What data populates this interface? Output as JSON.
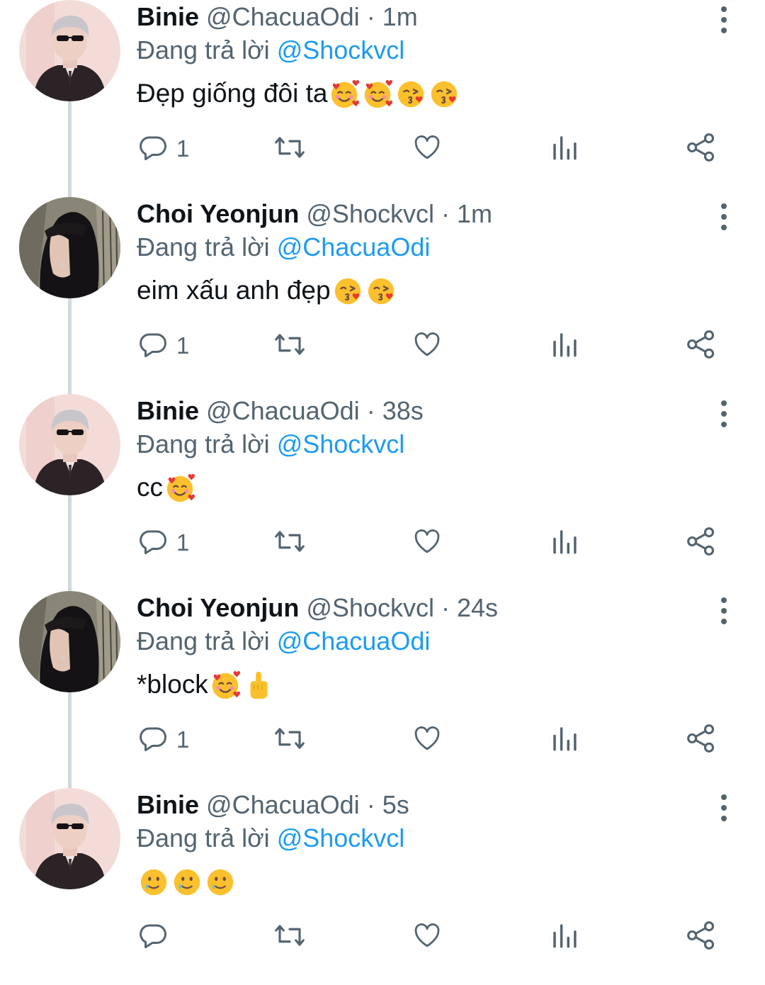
{
  "labels": {
    "replying_to": "Đang trả lời"
  },
  "tweets": [
    {
      "name": "Binie",
      "handle": "@ChacuaOdi",
      "separator": "·",
      "time": "1m",
      "reply_to": "@Shockvcl",
      "text": "Đẹp giống đôi ta",
      "emojis": [
        "smiling-face-with-hearts",
        "smiling-face-with-hearts",
        "face-blowing-kiss",
        "face-blowing-kiss"
      ],
      "reply_count": "1",
      "avatar": "binie"
    },
    {
      "name": "Choi Yeonjun",
      "handle": "@Shockvcl",
      "separator": "·",
      "time": "1m",
      "reply_to": "@ChacuaOdi",
      "text": "eim xấu anh đẹp",
      "emojis": [
        "face-blowing-kiss",
        "face-blowing-kiss"
      ],
      "reply_count": "1",
      "avatar": "yeonjun"
    },
    {
      "name": "Binie",
      "handle": "@ChacuaOdi",
      "separator": "·",
      "time": "38s",
      "reply_to": "@Shockvcl",
      "text": "cc",
      "emojis": [
        "smiling-face-with-hearts"
      ],
      "reply_count": "1",
      "avatar": "binie"
    },
    {
      "name": "Choi Yeonjun",
      "handle": "@Shockvcl",
      "separator": "·",
      "time": "24s",
      "reply_to": "@ChacuaOdi",
      "text": "*block ",
      "emojis": [
        "smiling-face-with-hearts",
        "middle-finger"
      ],
      "reply_count": "1",
      "avatar": "yeonjun"
    },
    {
      "name": "Binie",
      "handle": "@ChacuaOdi",
      "separator": "·",
      "time": "5s",
      "reply_to": "@Shockvcl",
      "text": "",
      "emojis": [
        "smiling-face-with-tear",
        "smiling-face-with-tear",
        "smiling-face-with-tear"
      ],
      "reply_count": "",
      "avatar": "binie"
    }
  ],
  "icons": {
    "reply": "reply-icon",
    "retweet": "retweet-icon",
    "like": "heart-icon",
    "views": "analytics-icon",
    "share": "share-icon",
    "more": "more-vertical-icon"
  },
  "colors": {
    "name": "#0f1419",
    "secondary": "#536471",
    "mention": "#1d9bf0",
    "thread_line": "#cfd9de"
  }
}
